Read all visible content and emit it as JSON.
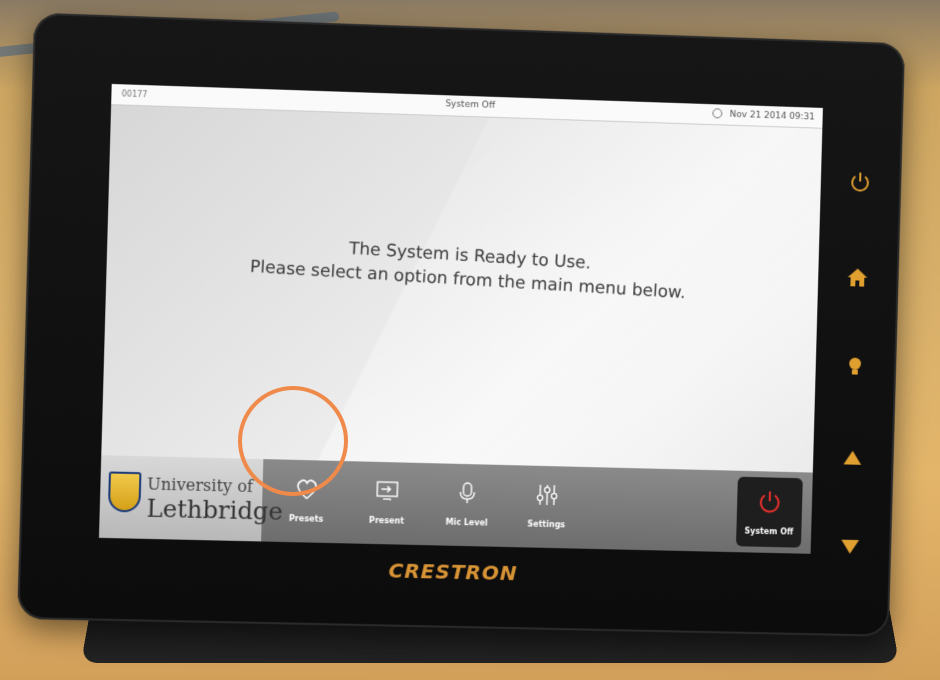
{
  "status_bar": {
    "left_text": "00177",
    "title": "System Off",
    "datetime": "Nov 21 2014 09:31"
  },
  "message": {
    "line1": "The System is Ready to Use.",
    "line2": "Please select an option from the main menu below."
  },
  "logo": {
    "line1": "University of",
    "line2": "Lethbridge"
  },
  "nav": [
    {
      "label": "Presets",
      "icon": "heart-icon"
    },
    {
      "label": "Present",
      "icon": "display-input-icon"
    },
    {
      "label": "Mic Level",
      "icon": "microphone-icon"
    },
    {
      "label": "Settings",
      "icon": "sliders-icon"
    }
  ],
  "system_off_button": {
    "label": "System Off",
    "icon": "power-icon"
  },
  "side_buttons": [
    "power-icon",
    "home-icon",
    "lightbulb-icon",
    "arrow-up-icon",
    "arrow-down-icon"
  ],
  "brand": "CRESTRON",
  "colors": {
    "accent_power": "#e3302b",
    "highlight_circle": "#f08a4b",
    "brand_text": "#d99436",
    "side_buttons": "#e0a030"
  }
}
